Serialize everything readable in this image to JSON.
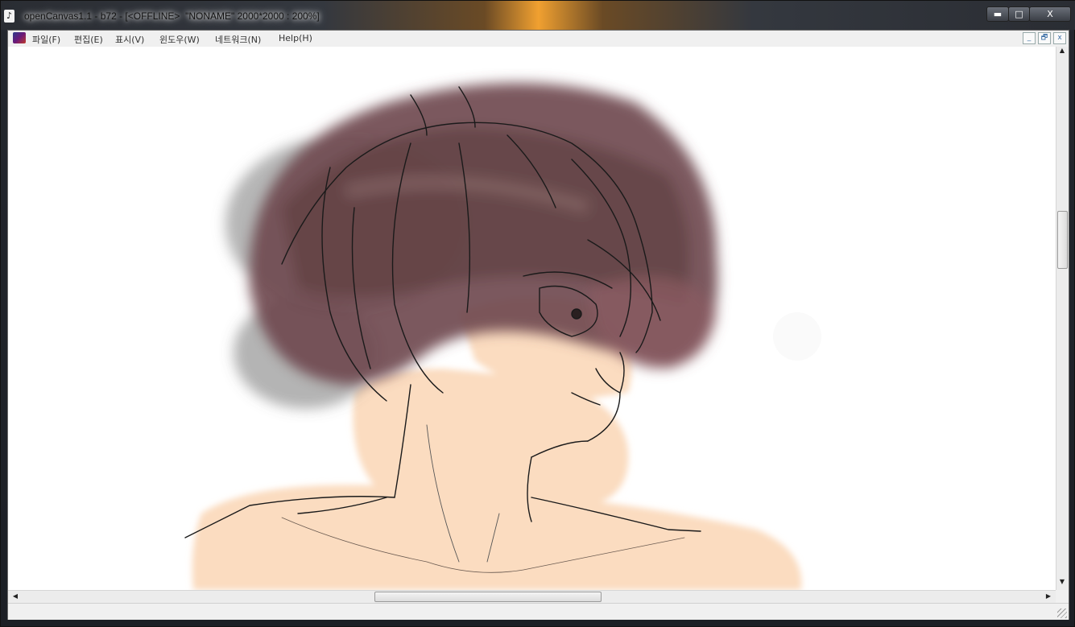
{
  "window": {
    "title": "openCanvas1.1 - b72 - [<OFFLINE>  \"NONAME\" 2000*2000 : 200%]",
    "controls": {
      "minimize": "▬",
      "maximize": "□",
      "close": "X"
    }
  },
  "menu": {
    "items": [
      {
        "label": "파일(F)"
      },
      {
        "label": "편집(E)"
      },
      {
        "label": "표시(V)"
      },
      {
        "label": "윈도우(W)"
      },
      {
        "label": "네트워크(N)"
      },
      {
        "label": "Help(H)"
      }
    ],
    "mdi_controls": {
      "minimize": "_",
      "restore": "🗗",
      "close": "x"
    }
  },
  "scrollbars": {
    "up": "▲",
    "down": "▼",
    "left": "◀",
    "right": "▶"
  },
  "canvas": {
    "content": "drawing-of-person-with-dark-hair",
    "colors": {
      "hair": "#6e4a4e",
      "skin": "#fbdcc0",
      "line": "#1a1a1a"
    }
  }
}
